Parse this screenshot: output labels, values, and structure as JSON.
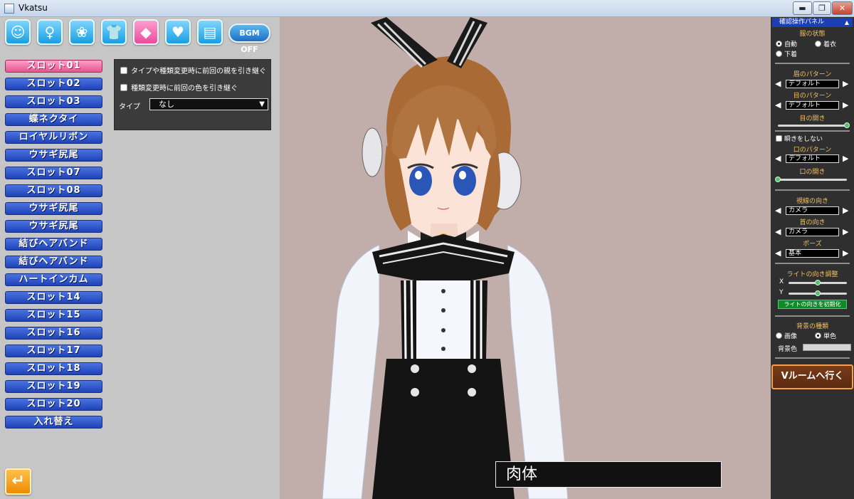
{
  "window": {
    "title": "Vkatsu",
    "min_label": "▬",
    "max_label": "❐",
    "close_label": "✕"
  },
  "toolbar": {
    "icons": [
      {
        "name": "face",
        "glyph": "☺"
      },
      {
        "name": "body",
        "glyph": "♀"
      },
      {
        "name": "hair",
        "glyph": "❀"
      },
      {
        "name": "clothes",
        "glyph": "👕"
      },
      {
        "name": "accessory",
        "glyph": "◆"
      },
      {
        "name": "favorite",
        "glyph": "♥"
      },
      {
        "name": "document",
        "glyph": "▤"
      }
    ],
    "bgm_label": "BGM OFF"
  },
  "slots": [
    "スロット01",
    "スロット02",
    "スロット03",
    "蝶ネクタイ",
    "ロイヤルリボン",
    "ウサギ尻尾",
    "スロット07",
    "スロット08",
    "ウサギ尻尾",
    "ウサギ尻尾",
    "結びヘアバンド",
    "結びヘアバンド",
    "ハートインカム",
    "スロット14",
    "スロット15",
    "スロット16",
    "スロット17",
    "スロット18",
    "スロット19",
    "スロット20"
  ],
  "swap_label": "入れ替え",
  "options": {
    "inherit_parent": "タイプや種類変更時に前回の親を引き継ぐ",
    "inherit_color": "種類変更時に前回の色を引き継ぐ",
    "type_label": "タイプ",
    "type_value": "なし"
  },
  "viewport": {
    "name_box": "肉体"
  },
  "right_panel": {
    "header": "確認操作パネル",
    "clothes_state": {
      "title": "服の状態",
      "auto": "自動",
      "wear": "着衣",
      "underwear": "下着"
    },
    "eyebrow": {
      "title": "眉のパターン",
      "value": "デフォルト"
    },
    "eye": {
      "title": "目のパターン",
      "value": "デフォルト"
    },
    "eye_open": {
      "title": "目の開き",
      "level": 1.0
    },
    "no_blink": "瞬きをしない",
    "mouth": {
      "title": "口のパターン",
      "value": "デフォルト"
    },
    "mouth_open": {
      "title": "口の開き",
      "level": 0.0
    },
    "gaze": {
      "title": "視線の向き",
      "value": "カメラ"
    },
    "neck": {
      "title": "首の向き",
      "value": "カメラ"
    },
    "pose": {
      "title": "ポーズ",
      "value": "基本"
    },
    "light": {
      "title": "ライトの向き調整",
      "x_label": "X",
      "y_label": "Y",
      "x_level": 0.5,
      "y_level": 0.5,
      "reset": "ライトの向きを初期化"
    },
    "background": {
      "title": "背景の種類",
      "image": "画像",
      "solid": "単色",
      "color_label": "背景色"
    },
    "vroom_button": "Vルームへ行く"
  }
}
